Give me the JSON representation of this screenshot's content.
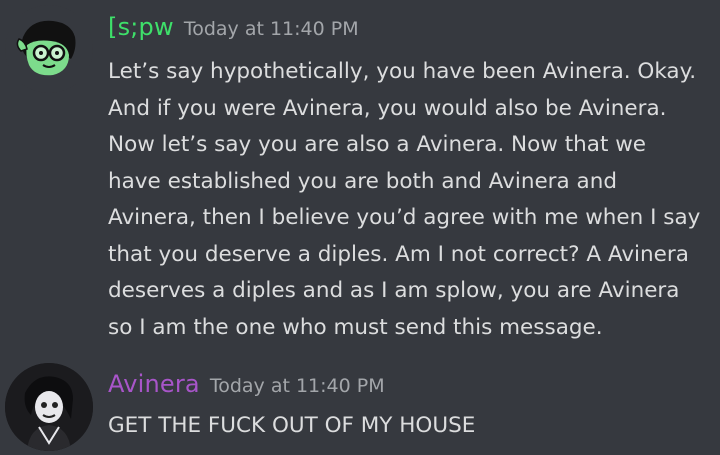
{
  "messages": [
    {
      "author": "[s;pw",
      "timestamp": "Today at 11:40 PM",
      "author_color": "#3ee06a",
      "avatar_icon": "green-goggles-face-icon",
      "lines": [
        "Let’s say hypothetically, you have been Avinera. Okay.",
        "And if you were Avinera, you would also be Avinera.",
        "Now let’s say you are also a Avinera. Now that we",
        "have established you are both and Avinera and",
        "Avinera, then I believe you’d agree with me when I say",
        "that you deserve a diples. Am I not correct? A Avinera",
        "deserves a diples and as I am splow, you are Avinera",
        "so I am the one who must send this message."
      ]
    },
    {
      "author": "Avinera",
      "timestamp": "Today at 11:40 PM",
      "author_color": "#a855c9",
      "avatar_icon": "dark-character-avatar-icon",
      "lines": [
        "GET THE FUCK OUT OF MY HOUSE"
      ]
    }
  ]
}
